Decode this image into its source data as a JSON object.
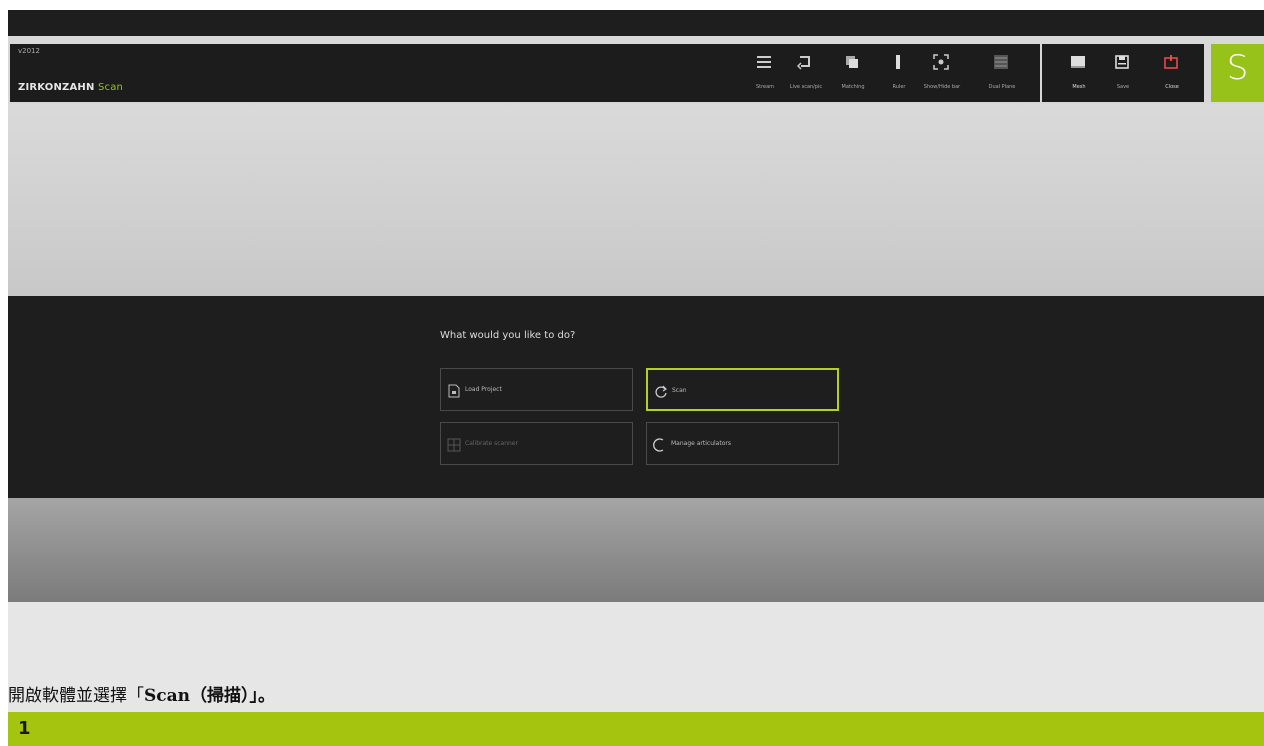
{
  "app": {
    "version": "v2012",
    "brand_name": "ZIRKONZAHN",
    "brand_product": "Scan",
    "logo_letter": "S"
  },
  "toolbar": {
    "items": [
      {
        "label": "Stream",
        "icon": "menu-lines-icon"
      },
      {
        "label": "Live scan/pic",
        "icon": "rotate-arrow-icon"
      },
      {
        "label": "Matching",
        "icon": "copy-stack-icon"
      },
      {
        "label": "Ruler",
        "icon": "ruler-icon"
      },
      {
        "label": "Show/Hide bar",
        "icon": "focus-frame-icon"
      },
      {
        "label": "Dual Plane",
        "icon": "grid-panel-icon"
      }
    ],
    "right_items": [
      {
        "label": "Mesh",
        "icon": "monitor-icon"
      },
      {
        "label": "Save",
        "icon": "save-disk-icon"
      },
      {
        "label": "Close",
        "icon": "power-icon"
      }
    ]
  },
  "dialog": {
    "title": "What would you like to do?",
    "options": [
      {
        "label": "Load Project",
        "icon": "document-icon",
        "selected": false,
        "enabled": true
      },
      {
        "label": "Scan",
        "icon": "scan-rotate-icon",
        "selected": true,
        "enabled": true
      },
      {
        "label": "Calibrate scanner",
        "icon": "calibrate-grid-icon",
        "selected": false,
        "enabled": false
      },
      {
        "label": "Manage articulators",
        "icon": "articulator-arc-icon",
        "selected": false,
        "enabled": true
      }
    ]
  },
  "instruction": {
    "text_plain": "開啟軟體並選擇「",
    "text_bold": "Scan（掃描）",
    "text_end": "」。"
  },
  "step": {
    "number": "1"
  },
  "colors": {
    "accent_green": "#97c21a",
    "close_red": "#e84a4a",
    "selected_border": "#b3d21e"
  }
}
